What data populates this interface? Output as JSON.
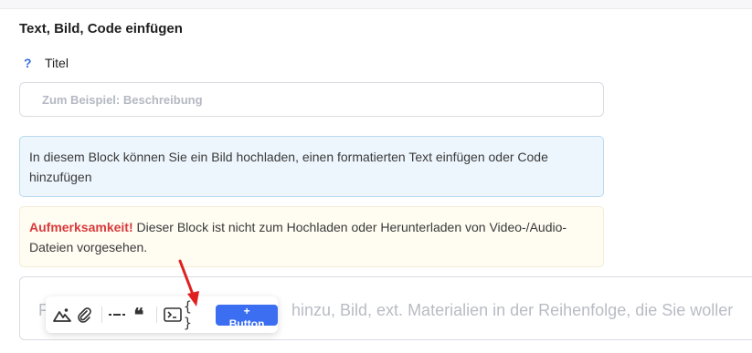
{
  "section": {
    "title": "Text, Bild, Code einfügen"
  },
  "title_field": {
    "help_icon": "?",
    "label": "Titel",
    "placeholder": "Zum Beispiel: Beschreibung"
  },
  "info": {
    "text": "In diesem Block können Sie ein Bild hochladen, einen formatierten Text einfügen oder Code hinzufügen"
  },
  "warning": {
    "strong": "Aufmerksamkeit!",
    "text": " Dieser Block ist nicht zum Hochladen oder Herunterladen von Video-/Audio-Dateien vorgesehen."
  },
  "editor": {
    "placeholder_visible": "F… hinzu, Bild, ext. Materialien in der Reihenfolge, die Sie woller",
    "placeholder_left": "F",
    "placeholder_right": "hinzu, Bild, ext. Materialien in der Reihenfolge, die Sie woller"
  },
  "toolbar": {
    "icons": [
      "image-icon",
      "attachment-icon",
      "divider-icon",
      "quote-icon",
      "terminal-icon",
      "code-braces-icon"
    ],
    "quote_glyph": "❝",
    "code_glyph": "{ }",
    "add_button_label": "+ Button"
  },
  "colors": {
    "accent": "#3b6ef0",
    "warning": "#d93a3a",
    "info_bg": "#edf6fd",
    "arrow": "#e02020"
  }
}
